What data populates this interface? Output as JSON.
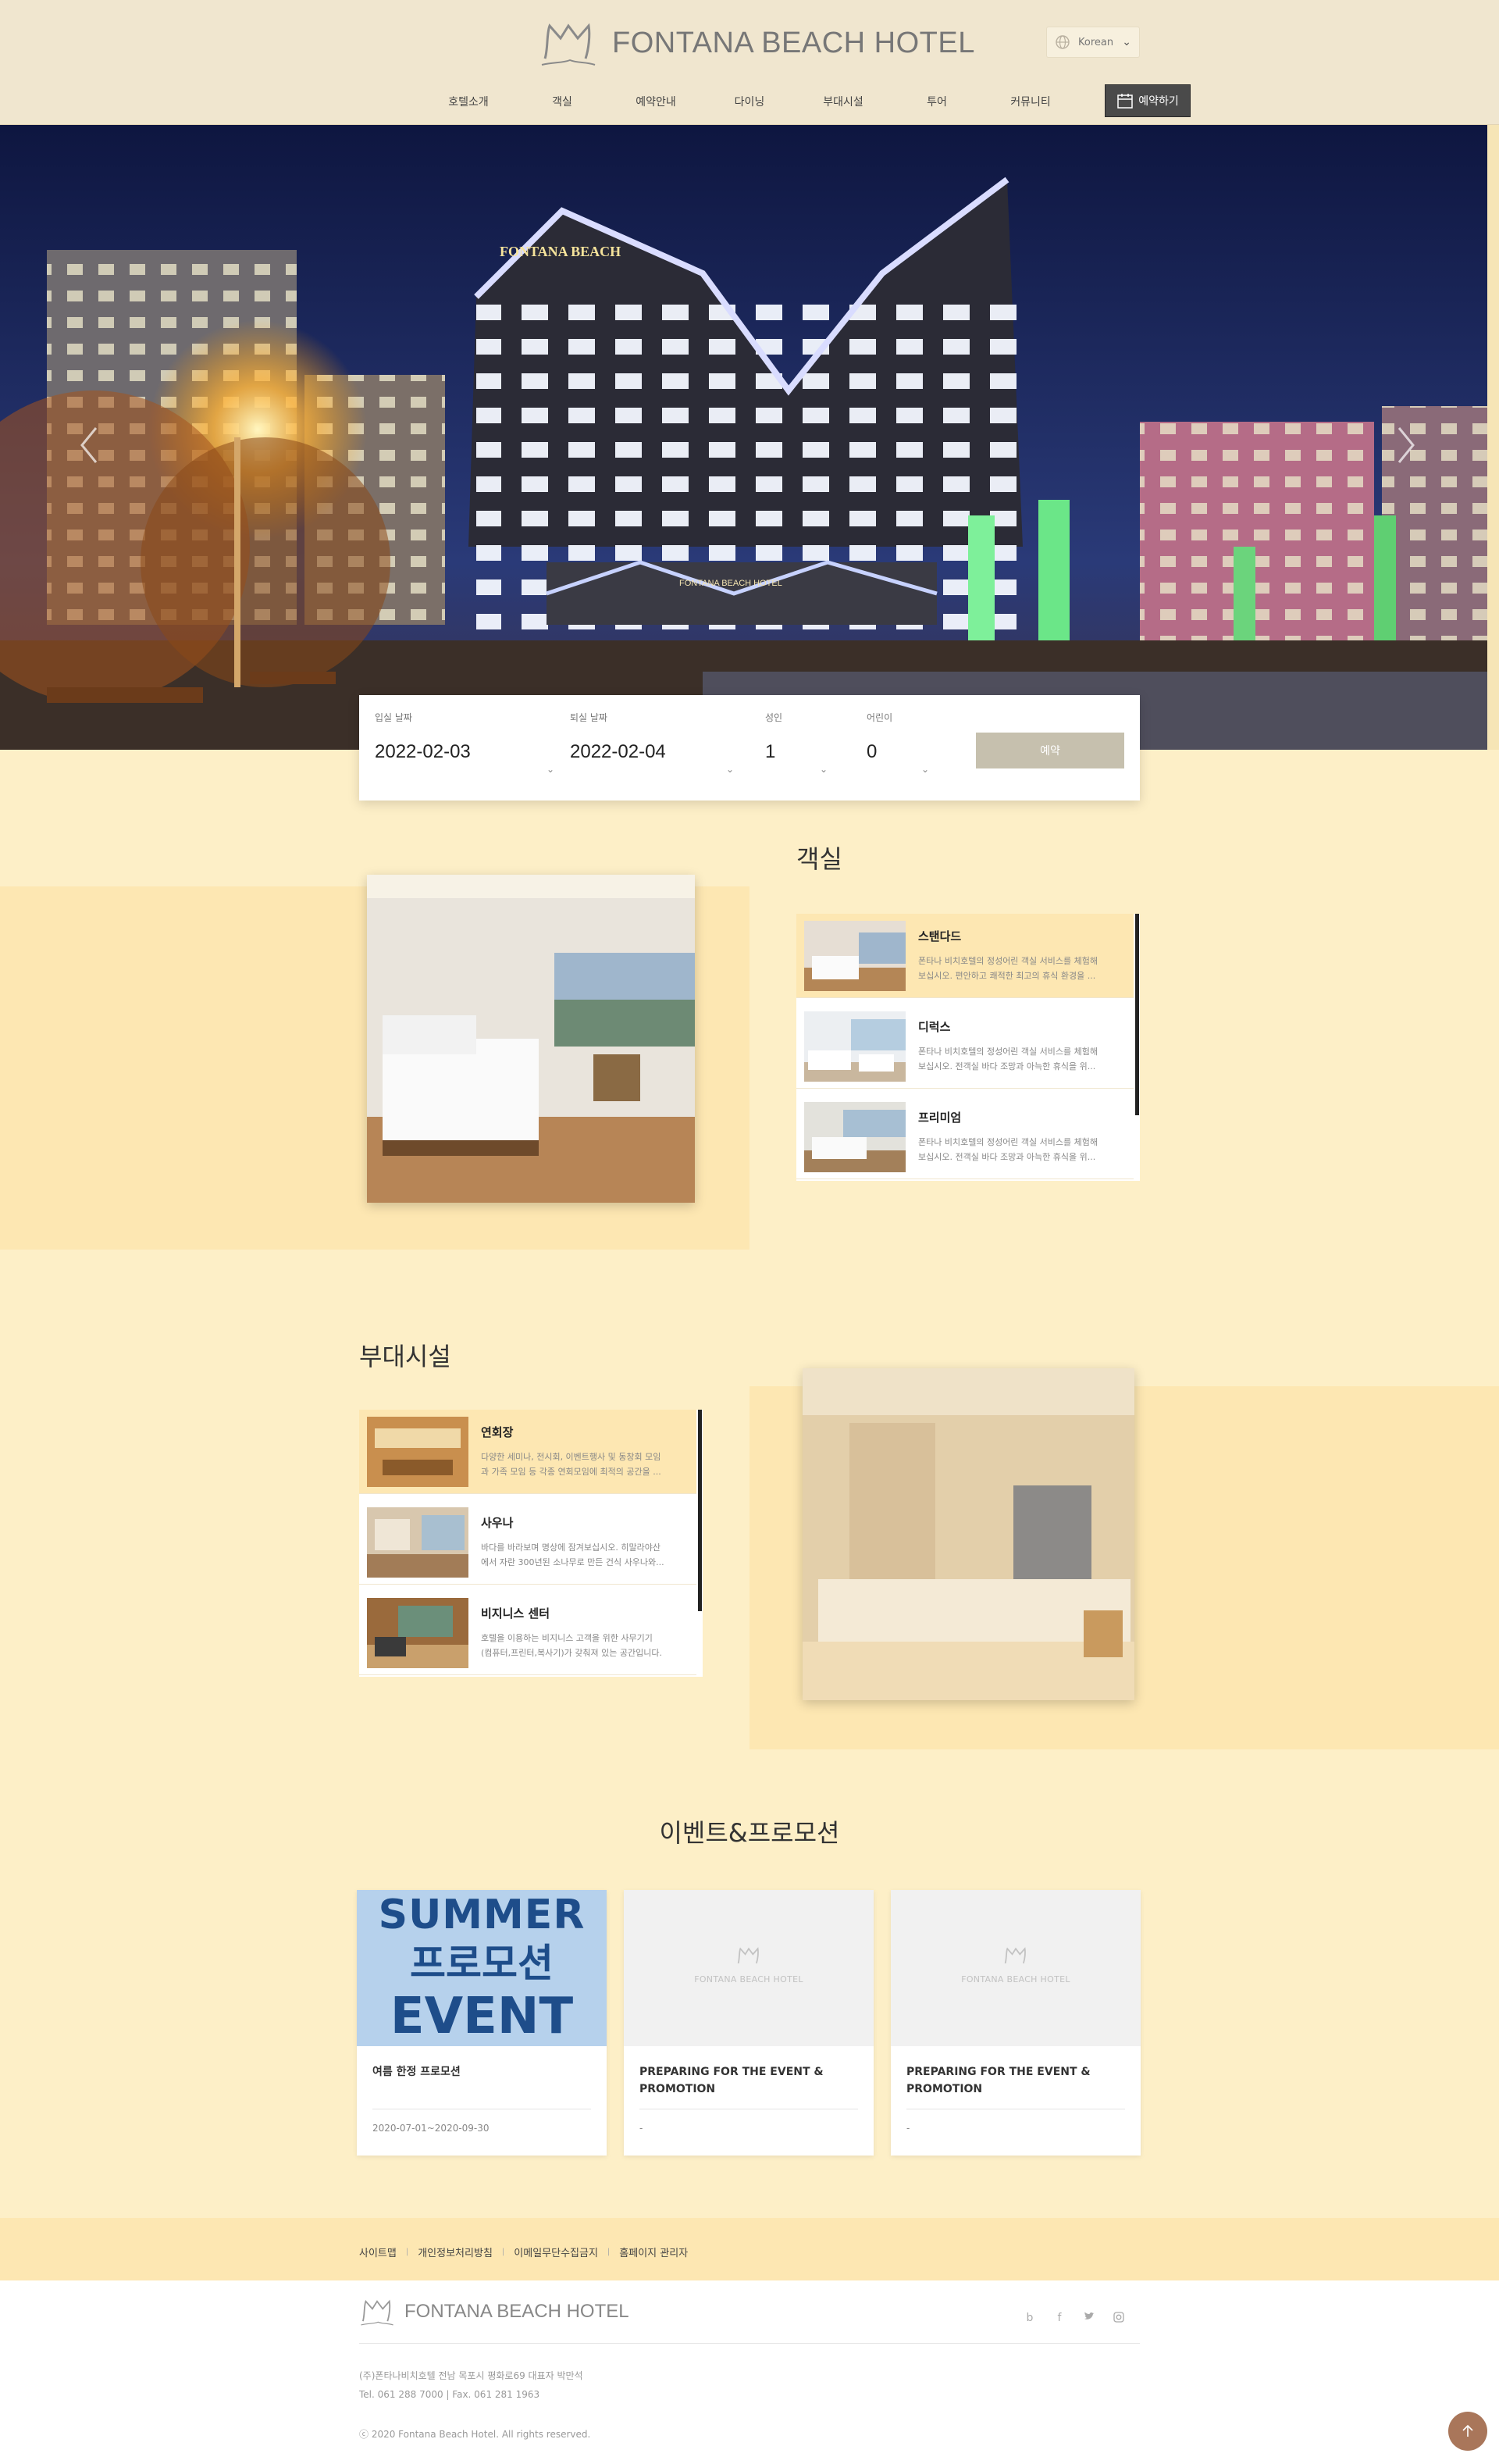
{
  "header": {
    "logo_text": "FONTANA BEACH HOTEL",
    "language": "Korean",
    "nav": [
      "호텔소개",
      "객실",
      "예약안내",
      "다이닝",
      "부대시설",
      "투어",
      "커뮤니티"
    ],
    "reserve_label": "예약하기"
  },
  "booking": {
    "checkin_label": "입실 날짜",
    "checkin_value": "2022-02-03",
    "checkout_label": "퇴실 날짜",
    "checkout_value": "2022-02-04",
    "adult_label": "성인",
    "adult_value": "1",
    "child_label": "어린이",
    "child_value": "0",
    "submit_label": "예약"
  },
  "hero": {
    "building_sign": "FONTANA BEACH",
    "entrance_sign": "FONTANA BEACH HOTEL"
  },
  "rooms": {
    "title": "객실",
    "items": [
      {
        "name": "스탠다드",
        "desc1": "폰타나 비치호텔의 정성어린 객실 서비스를 체험해",
        "desc2": "보십시오. 편안하고 쾌적한 최고의 휴식 환경을 ..."
      },
      {
        "name": "디럭스",
        "desc1": "폰타나 비치호텔의 정성어린 객실 서비스를 체험해",
        "desc2": "보십시오. 전객실 바다 조망과 아늑한 휴식을 위..."
      },
      {
        "name": "프리미엄",
        "desc1": "폰타나 비치호텔의 정성어린 객실 서비스를 체험해",
        "desc2": "보십시오. 전객실 바다 조망과 아늑한 휴식을 위..."
      }
    ]
  },
  "facilities": {
    "title": "부대시설",
    "items": [
      {
        "name": "연회장",
        "desc1": "다양한 세미나, 전시회, 이벤트행사 및 동창회 모임",
        "desc2": "과 가족 모임 등 각종 연회모임에 최적의 공간을 ..."
      },
      {
        "name": "사우나",
        "desc1": "바다를 바라보며 명상에 잠겨보십시오. 히말라야산",
        "desc2": "에서 자란 300년된 소나무로 만든 건식 사우나와..."
      },
      {
        "name": "비지니스 센터",
        "desc1": "호텔을 이용하는 비지니스 고객을 위한 사무기기",
        "desc2": "(컴퓨터,프린터,복사기)가 갖춰져 있는 공간입니다."
      }
    ]
  },
  "events": {
    "title": "이벤트&프로모션",
    "banner": {
      "line1": "SUMMER",
      "line2": "프로모션",
      "line3": "EVENT"
    },
    "placeholder_text": "FONTANA BEACH HOTEL",
    "cards": [
      {
        "name": "여름 한정 프로모션",
        "date": "2020-07-01~2020-09-30"
      },
      {
        "name": "PREPARING FOR THE EVENT & PROMOTION",
        "date": "-"
      },
      {
        "name": "PREPARING FOR THE EVENT & PROMOTION",
        "date": "-"
      }
    ]
  },
  "footer": {
    "links": [
      "사이트맵",
      "개인정보처리방침",
      "이메일무단수집금지",
      "홈페이지 관리자"
    ],
    "logo_text": "FONTANA BEACH HOTEL",
    "social": [
      "b",
      "f",
      "t",
      "instagram"
    ],
    "info1": "(주)폰타나비치호텔 전남 목포시 평화로69 대표자 박만석",
    "info2": "Tel. 061 288 7000 | Fax. 061 281 1963",
    "copyright": "ⓒ 2020 Fontana Beach Hotel. All rights reserved."
  },
  "colors": {
    "page_bg": "#fdefc7",
    "band": "#fde7b2",
    "header_bg": "#f0e6cf",
    "reserve_btn": "#4a4a4a",
    "submit_btn": "#c6c0ae",
    "totop": "#a9765a",
    "event_banner": "#b6d1ec",
    "event_banner_text": "#1e4d8a"
  }
}
